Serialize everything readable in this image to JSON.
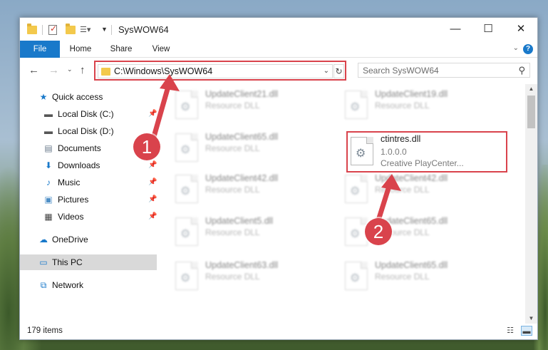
{
  "window": {
    "title": "SysWOW64"
  },
  "ribbon": {
    "tabs": [
      "File",
      "Home",
      "Share",
      "View"
    ],
    "help": "?"
  },
  "nav": {
    "address": "C:\\Windows\\SysWOW64",
    "search_placeholder": "Search SysWOW64"
  },
  "sidebar": {
    "items": [
      {
        "label": "Quick access",
        "icon": "star-icon"
      },
      {
        "label": "Local Disk (C:)",
        "icon": "drive-icon"
      },
      {
        "label": "Local Disk (D:)",
        "icon": "drive-icon"
      },
      {
        "label": "Documents",
        "icon": "documents-icon"
      },
      {
        "label": "Downloads",
        "icon": "downloads-icon"
      },
      {
        "label": "Music",
        "icon": "music-icon"
      },
      {
        "label": "Pictures",
        "icon": "pictures-icon"
      },
      {
        "label": "Videos",
        "icon": "videos-icon"
      },
      {
        "label": "OneDrive",
        "icon": "cloud-icon"
      },
      {
        "label": "This PC",
        "icon": "computer-icon"
      },
      {
        "label": "Network",
        "icon": "network-icon"
      }
    ]
  },
  "files": [
    {
      "name": "UpdateClient21.dll",
      "type": "Resource DLL"
    },
    {
      "name": "UpdateClient19.dll",
      "type": "Resource DLL"
    },
    {
      "name": "UpdateClient65.dll",
      "type": "Resource DLL"
    },
    {
      "name": "UpdateClient42.dll",
      "type": "Resource DLL"
    },
    {
      "name": "UpdateClient42.dll",
      "type": "Resource DLL"
    },
    {
      "name": "UpdateClient5.dll",
      "type": "Resource DLL"
    },
    {
      "name": "UpdateClient65.dll",
      "type": "Resource DLL"
    },
    {
      "name": "UpdateClient63.dll",
      "type": "Resource DLL"
    },
    {
      "name": "UpdateClient65.dll",
      "type": "Resource DLL"
    }
  ],
  "highlighted_file": {
    "name": "ctintres.dll",
    "version": "1.0.0.0",
    "company": "Creative PlayCenter..."
  },
  "status": {
    "items_count": "179 items"
  },
  "annotations": {
    "step1": "1",
    "step2": "2",
    "color": "#d9434c"
  }
}
